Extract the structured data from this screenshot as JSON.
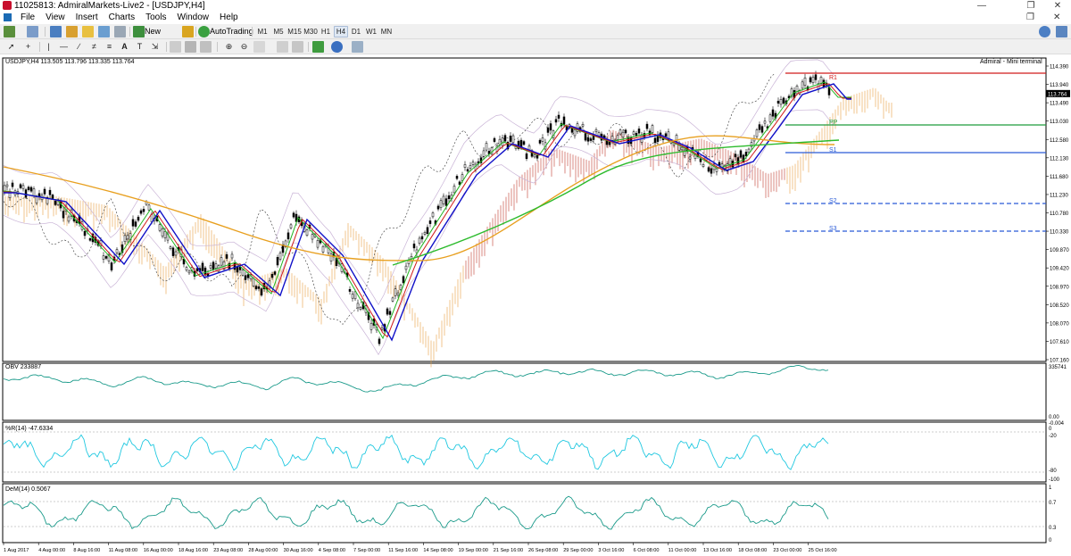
{
  "window": {
    "title": "11025813: AdmiralMarkets-Live2 - [USDJPY,H4]",
    "minimize": "—",
    "maximize": "❐",
    "close": "✕"
  },
  "menu": {
    "items": [
      "File",
      "View",
      "Insert",
      "Charts",
      "Tools",
      "Window",
      "Help"
    ],
    "restore": "❐",
    "close": "✕"
  },
  "toolbar": {
    "new_order_label": "New Order",
    "autotrading_label": "AutoTrading",
    "timeframes": [
      "M1",
      "M5",
      "M15",
      "M30",
      "H1",
      "H4",
      "D1",
      "W1",
      "MN"
    ],
    "active_timeframe": "H4"
  },
  "chart": {
    "header": "USDJPY,H4  113.505 113.796 113.335 113.764",
    "terminal_label": "Admiral - Mini terminal",
    "price_labels": [
      "114.390",
      "113.940",
      "113.490",
      "113.030",
      "112.580",
      "112.130",
      "111.680",
      "111.230",
      "110.780",
      "110.330",
      "109.870",
      "109.420",
      "108.970",
      "108.520",
      "108.070",
      "107.610",
      "107.160"
    ],
    "current_price": "113.764",
    "levels": [
      {
        "name": "R1",
        "color": "#d11a1a",
        "dash": false
      },
      {
        "name": "PP",
        "color": "#1e9c3c",
        "dash": false
      },
      {
        "name": "S1",
        "color": "#2a5bd7",
        "dash": false
      },
      {
        "name": "S2",
        "color": "#2a5bd7",
        "dash": true
      },
      {
        "name": "S3",
        "color": "#2a5bd7",
        "dash": true
      }
    ],
    "time_labels": [
      "1 Aug 2017",
      "4 Aug 00:00",
      "8 Aug 16:00",
      "11 Aug 08:00",
      "16 Aug 00:00",
      "18 Aug 16:00",
      "23 Aug 08:00",
      "28 Aug 00:00",
      "30 Aug 16:00",
      "4 Sep 08:00",
      "7 Sep 00:00",
      "11 Sep 16:00",
      "14 Sep 08:00",
      "19 Sep 00:00",
      "21 Sep 16:00",
      "26 Sep 08:00",
      "29 Sep 00:00",
      "3 Oct 16:00",
      "6 Oct 08:00",
      "11 Oct 00:00",
      "13 Oct 16:00",
      "18 Oct 08:00",
      "23 Oct 00:00",
      "25 Oct 16:00"
    ]
  },
  "obv": {
    "label": "OBV 233887",
    "top_value": "335741",
    "bottom_value": "0.00"
  },
  "wpr": {
    "label": "%R(14) -47.6334",
    "values": [
      "-0.004",
      "0",
      "-20",
      "-80",
      "-100"
    ]
  },
  "dem": {
    "label": "DeM(14) 0.5067",
    "values": [
      "1",
      "0.7",
      "0.3",
      "0"
    ]
  },
  "colors": {
    "bull_candle": "#ffffff",
    "bear_candle": "#000000",
    "ma_red": "#d11a1a",
    "ma_green": "#21b521",
    "ma_blue": "#1010c8",
    "ma_orange": "#e8a020",
    "ma_green_slow": "#2dbb2d",
    "envelope": "#c9b3d6",
    "cloud_red": "#c0392b",
    "cloud_orange": "#e8a040",
    "obv_color": "#1a9a8a",
    "wpr_color": "#20c8e0",
    "dem_color": "#1a9a8a"
  }
}
